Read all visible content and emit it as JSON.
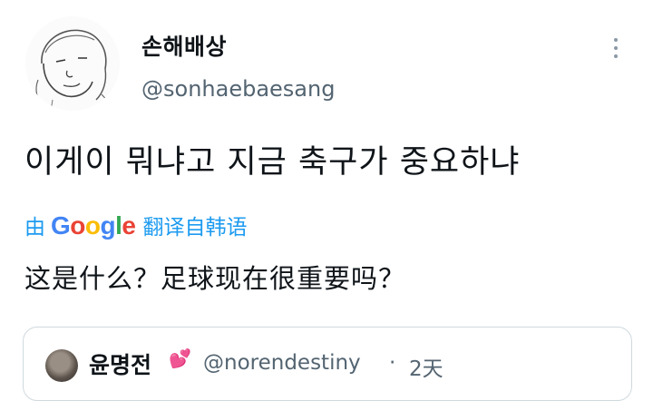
{
  "tweet": {
    "display_name": "손해배상",
    "handle": "@sonhaebaesang",
    "text": "이게이 뭐냐고 지금 축구가 중요하냐",
    "more_icon": "more-horizontal-icon"
  },
  "translation": {
    "prefix": "由",
    "provider_letters": [
      "G",
      "o",
      "o",
      "g",
      "l",
      "e"
    ],
    "provider_colors": [
      "#4285F4",
      "#EA4335",
      "#FBBC05",
      "#4285F4",
      "#34A853",
      "#EA4335"
    ],
    "suffix": "翻译自韩语",
    "text": "这是什么？足球现在很重要吗？"
  },
  "quoted_tweet": {
    "display_name": "윤명전",
    "heart_icon": "heart-emoji-icon",
    "handle": "@norendestiny",
    "separator": "·",
    "time": "2天"
  },
  "colors": {
    "link_blue": "#1d9bf0",
    "secondary_text": "#536471",
    "primary_text": "#0f1419",
    "heart": "#e0245e"
  }
}
